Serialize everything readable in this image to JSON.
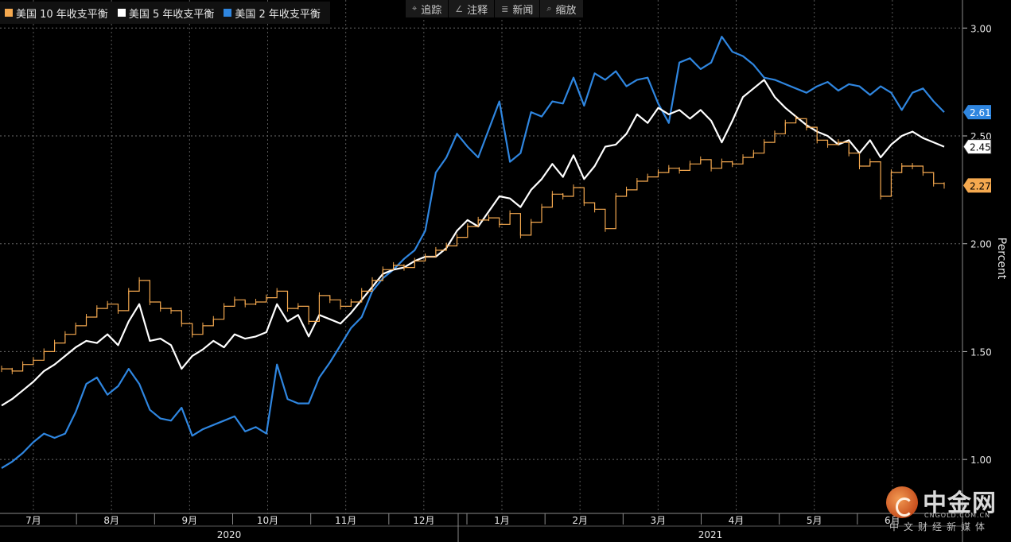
{
  "toolbar": [
    {
      "icon": "crosshair-icon",
      "glyph": "⌖",
      "label": "追踪"
    },
    {
      "icon": "annotate-icon",
      "glyph": "∠",
      "label": "注释"
    },
    {
      "icon": "news-icon",
      "glyph": "≣",
      "label": "新闻"
    },
    {
      "icon": "zoom-icon",
      "glyph": "⌕",
      "label": "缩放"
    }
  ],
  "logo": {
    "cn": "中金网",
    "en": "CNGOLD.COM.CN",
    "sub": "中文财经新媒体"
  },
  "chart_data": {
    "type": "line",
    "ylabel": "Percent",
    "ylim": [
      0.75,
      3.13
    ],
    "yticks": [
      "1.00",
      "1.50",
      "2.00",
      "2.50",
      "3.00"
    ],
    "grid": true,
    "legend_position": "top-left",
    "x_months": [
      "7月",
      "8月",
      "9月",
      "10月",
      "11月",
      "12月",
      "1月",
      "2月",
      "3月",
      "4月",
      "5月",
      "6月"
    ],
    "x_years": [
      "2020",
      "2021"
    ],
    "series": [
      {
        "name": "美国 10 年收支平衡",
        "color": "#f5a94f",
        "style": "step",
        "last_label": "2.27",
        "values": [
          1.42,
          1.41,
          1.44,
          1.46,
          1.5,
          1.54,
          1.58,
          1.62,
          1.66,
          1.7,
          1.72,
          1.69,
          1.78,
          1.83,
          1.73,
          1.7,
          1.69,
          1.63,
          1.58,
          1.62,
          1.65,
          1.71,
          1.74,
          1.72,
          1.73,
          1.75,
          1.78,
          1.7,
          1.71,
          1.64,
          1.76,
          1.74,
          1.71,
          1.73,
          1.78,
          1.83,
          1.88,
          1.9,
          1.89,
          1.92,
          1.94,
          1.97,
          1.99,
          2.03,
          2.08,
          2.11,
          2.12,
          2.09,
          2.14,
          2.04,
          2.1,
          2.17,
          2.23,
          2.22,
          2.26,
          2.19,
          2.16,
          2.07,
          2.22,
          2.25,
          2.29,
          2.31,
          2.33,
          2.35,
          2.34,
          2.37,
          2.39,
          2.35,
          2.38,
          2.37,
          2.4,
          2.42,
          2.47,
          2.51,
          2.56,
          2.58,
          2.54,
          2.48,
          2.46,
          2.47,
          2.42,
          2.36,
          2.38,
          2.22,
          2.33,
          2.36,
          2.36,
          2.33,
          2.28,
          2.27
        ]
      },
      {
        "name": "美国 5 年收支平衡",
        "color": "#ffffff",
        "style": "line",
        "last_label": "2.45",
        "values": [
          1.25,
          1.28,
          1.32,
          1.36,
          1.41,
          1.44,
          1.48,
          1.52,
          1.55,
          1.54,
          1.58,
          1.53,
          1.64,
          1.72,
          1.55,
          1.56,
          1.53,
          1.42,
          1.48,
          1.51,
          1.55,
          1.52,
          1.58,
          1.56,
          1.57,
          1.59,
          1.72,
          1.64,
          1.67,
          1.57,
          1.67,
          1.65,
          1.63,
          1.68,
          1.74,
          1.8,
          1.86,
          1.88,
          1.89,
          1.92,
          1.94,
          1.94,
          1.98,
          2.06,
          2.11,
          2.08,
          2.15,
          2.22,
          2.21,
          2.17,
          2.25,
          2.3,
          2.37,
          2.31,
          2.41,
          2.3,
          2.36,
          2.45,
          2.46,
          2.51,
          2.6,
          2.56,
          2.63,
          2.6,
          2.62,
          2.58,
          2.62,
          2.57,
          2.47,
          2.57,
          2.68,
          2.72,
          2.76,
          2.68,
          2.63,
          2.59,
          2.55,
          2.52,
          2.5,
          2.46,
          2.48,
          2.42,
          2.48,
          2.4,
          2.46,
          2.5,
          2.52,
          2.49,
          2.47,
          2.45
        ]
      },
      {
        "name": "美国 2 年收支平衡",
        "color": "#2f86e0",
        "style": "line",
        "last_label": "2.61",
        "values": [
          0.96,
          0.99,
          1.03,
          1.08,
          1.12,
          1.1,
          1.12,
          1.22,
          1.35,
          1.38,
          1.3,
          1.34,
          1.42,
          1.35,
          1.23,
          1.19,
          1.18,
          1.24,
          1.11,
          1.14,
          1.16,
          1.18,
          1.2,
          1.13,
          1.15,
          1.12,
          1.44,
          1.28,
          1.26,
          1.26,
          1.38,
          1.45,
          1.53,
          1.61,
          1.66,
          1.78,
          1.84,
          1.88,
          1.93,
          1.97,
          2.06,
          2.33,
          2.4,
          2.51,
          2.45,
          2.4,
          2.53,
          2.66,
          2.38,
          2.42,
          2.61,
          2.59,
          2.66,
          2.65,
          2.77,
          2.64,
          2.79,
          2.76,
          2.8,
          2.73,
          2.76,
          2.77,
          2.65,
          2.56,
          2.84,
          2.86,
          2.81,
          2.84,
          2.96,
          2.89,
          2.87,
          2.83,
          2.77,
          2.76,
          2.74,
          2.72,
          2.7,
          2.73,
          2.75,
          2.71,
          2.74,
          2.73,
          2.69,
          2.73,
          2.7,
          2.62,
          2.7,
          2.72,
          2.66,
          2.61
        ]
      }
    ]
  }
}
